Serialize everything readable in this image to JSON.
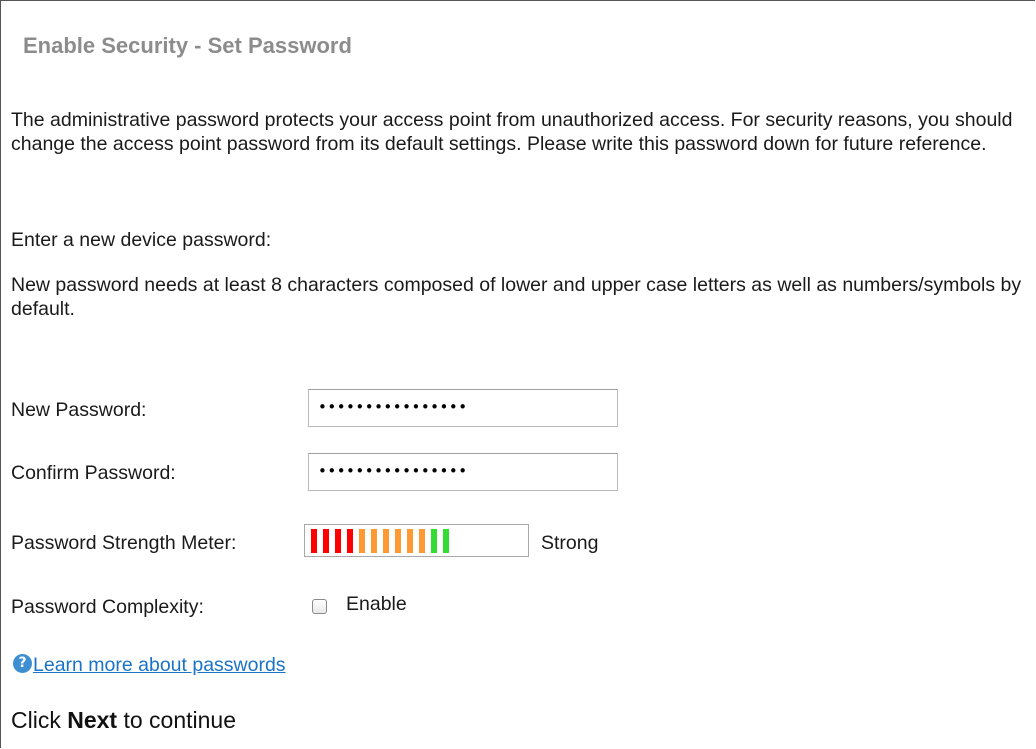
{
  "header": {
    "title": "Enable Security - Set Password"
  },
  "intro": "The administrative password protects your access point from unauthorized access. For security reasons, you should change the access point password from its default settings. Please write this password down for future reference.",
  "enter_prompt": "Enter a new device password:",
  "requirements": "New password needs at least 8 characters composed of lower and upper case letters as well as numbers/symbols by default.",
  "form": {
    "new_password": {
      "label": "New Password:",
      "value": "••••••••••••••••"
    },
    "confirm_password": {
      "label": "Confirm Password:",
      "value": "••••••••••••••••"
    },
    "strength_meter": {
      "label": "Password Strength Meter:",
      "result": "Strong",
      "filled_segments": 12,
      "total_segments": 18,
      "segment_colors": [
        "#ff0000",
        "#ff0000",
        "#ff0000",
        "#ff0000",
        "#ff9933",
        "#ff9933",
        "#ff9933",
        "#ff9933",
        "#ff9933",
        "#ff9933",
        "#33dd33",
        "#33dd33"
      ]
    },
    "complexity": {
      "label": "Password Complexity:",
      "checkbox_label": "Enable",
      "checked": false
    }
  },
  "help": {
    "link_text": "Learn more about passwords",
    "icon": "question-icon"
  },
  "footer": {
    "prefix": "Click ",
    "bold": "Next",
    "suffix": " to continue"
  }
}
